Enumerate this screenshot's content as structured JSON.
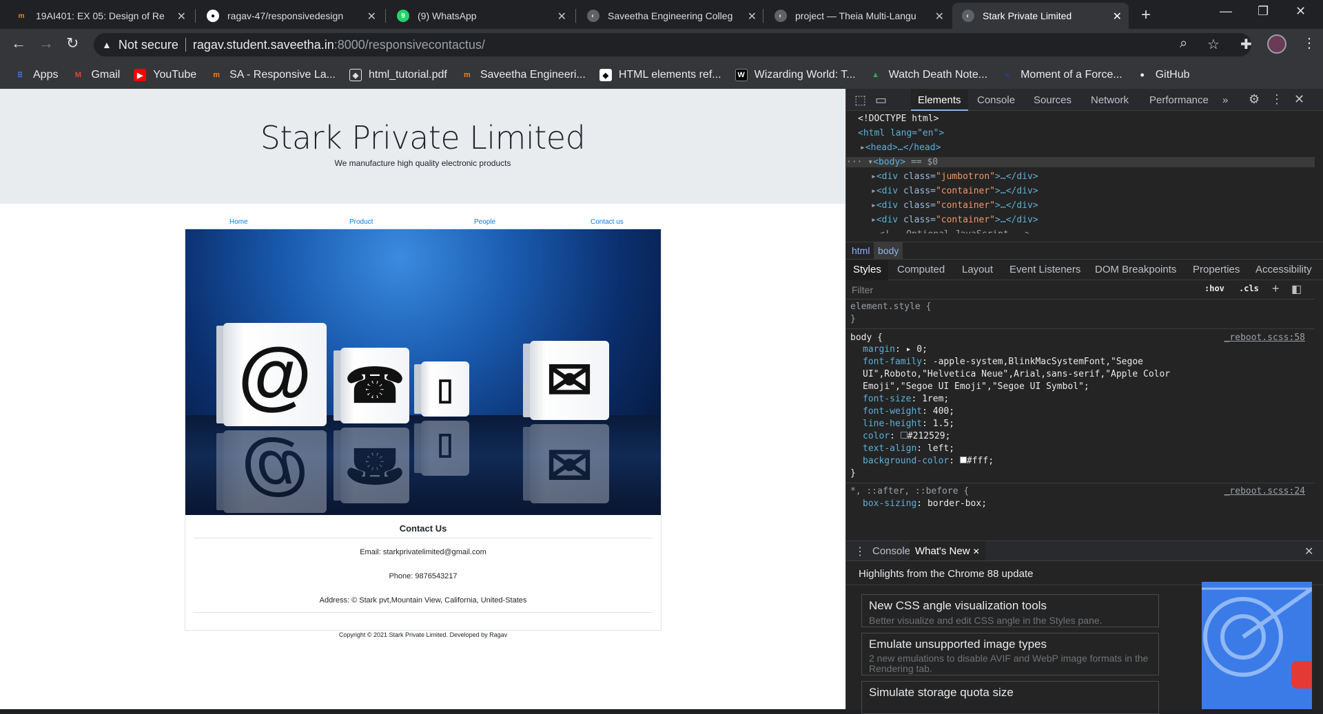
{
  "browser": {
    "tabs": [
      {
        "title": "19AI401: EX 05: Design of Re",
        "favicon": "moodle-icon"
      },
      {
        "title": "ragav-47/responsivedesign",
        "favicon": "github-icon"
      },
      {
        "title": "(9) WhatsApp",
        "favicon": "whatsapp-icon"
      },
      {
        "title": "Saveetha Engineering Colleg",
        "favicon": "globe-icon"
      },
      {
        "title": "project — Theia Multi-Langu",
        "favicon": "globe-icon"
      },
      {
        "title": "Stark Private Limited",
        "favicon": "globe-icon",
        "active": true
      }
    ],
    "address": {
      "security": "Not secure",
      "host": "ragav.student.saveetha.in",
      "path": ":8000/responsivecontactus/"
    },
    "bookmarks": [
      {
        "label": "Apps",
        "icon": "apps-grid-icon"
      },
      {
        "label": "Gmail",
        "icon": "gmail-icon"
      },
      {
        "label": "YouTube",
        "icon": "youtube-icon"
      },
      {
        "label": "SA - Responsive La...",
        "icon": "moodle-icon"
      },
      {
        "label": "html_tutorial.pdf",
        "icon": "pdf-icon"
      },
      {
        "label": "Saveetha Engineeri...",
        "icon": "moodle-icon"
      },
      {
        "label": "HTML elements ref...",
        "icon": "mdn-icon"
      },
      {
        "label": "Wizarding World: T...",
        "icon": "w-icon"
      },
      {
        "label": "Watch Death Note...",
        "icon": "anime-icon"
      },
      {
        "label": "Moment of a Force...",
        "icon": "circle-icon"
      },
      {
        "label": "GitHub",
        "icon": "github-icon"
      }
    ]
  },
  "site": {
    "title": "Stark Private Limited",
    "tagline": "We manufacture high quality electronic products",
    "nav": [
      "Home",
      "Product",
      "People",
      "Contact us"
    ],
    "contact": {
      "heading": "Contact Us",
      "email": "Email: starkprivatelimited@gmail.com",
      "phone": "Phone: 9876543217",
      "address": "Address: © Stark pvt,Mountain View, California, United-States"
    },
    "copyright": "Copyright © 2021 Stark Private Limited. Developed by Ragav"
  },
  "devtools": {
    "tabs": [
      "Elements",
      "Console",
      "Sources",
      "Network",
      "Performance"
    ],
    "dom": {
      "doctype": "<!DOCTYPE html>",
      "html_open": "<html lang=\"en\">",
      "head": "<head>…</head>",
      "body_sel": "== $0",
      "divs": [
        "jumbotron",
        "container",
        "container",
        "container"
      ],
      "comment": "<!-- Optional JavaScript -->"
    },
    "breadcrumbs": [
      "html",
      "body"
    ],
    "subtabs": [
      "Styles",
      "Computed",
      "Layout",
      "Event Listeners",
      "DOM Breakpoints",
      "Properties",
      "Accessibility"
    ],
    "filter_placeholder": "Filter",
    "filter_hov": ":hov",
    "filter_cls": ".cls",
    "styles": {
      "element_style": "element.style {",
      "body_selector": "body {",
      "body_source": "_reboot.scss:58",
      "props": [
        {
          "name": "margin",
          "value": "▸ 0;"
        },
        {
          "name": "font-family",
          "value": "-apple-system,BlinkMacSystemFont,\"Segoe UI\",Roboto,\"Helvetica Neue\",Arial,sans-serif,\"Apple Color Emoji\",\"Segoe UI Emoji\",\"Segoe UI Symbol\";"
        },
        {
          "name": "font-size",
          "value": "1rem;"
        },
        {
          "name": "font-weight",
          "value": "400;"
        },
        {
          "name": "line-height",
          "value": "1.5;"
        },
        {
          "name": "color",
          "value": "#212529;"
        },
        {
          "name": "text-align",
          "value": "left;"
        },
        {
          "name": "background-color",
          "value": "#fff;"
        }
      ],
      "universal_selector": "*, ::after, ::before {",
      "universal_source": "_reboot.scss:24",
      "universal_prop": {
        "name": "box-sizing",
        "value": "border-box;"
      }
    },
    "drawer": {
      "tabs": [
        "Console",
        "What's New"
      ],
      "headline": "Highlights from the Chrome 88 update",
      "cards": [
        {
          "title": "New CSS angle visualization tools",
          "desc": "Better visualize and edit CSS angle in the Styles pane."
        },
        {
          "title": "Emulate unsupported image types",
          "desc": "2 new emulations to disable AVIF and WebP image formats in the Rendering tab."
        },
        {
          "title": "Simulate storage quota size",
          "desc": ""
        }
      ]
    }
  }
}
